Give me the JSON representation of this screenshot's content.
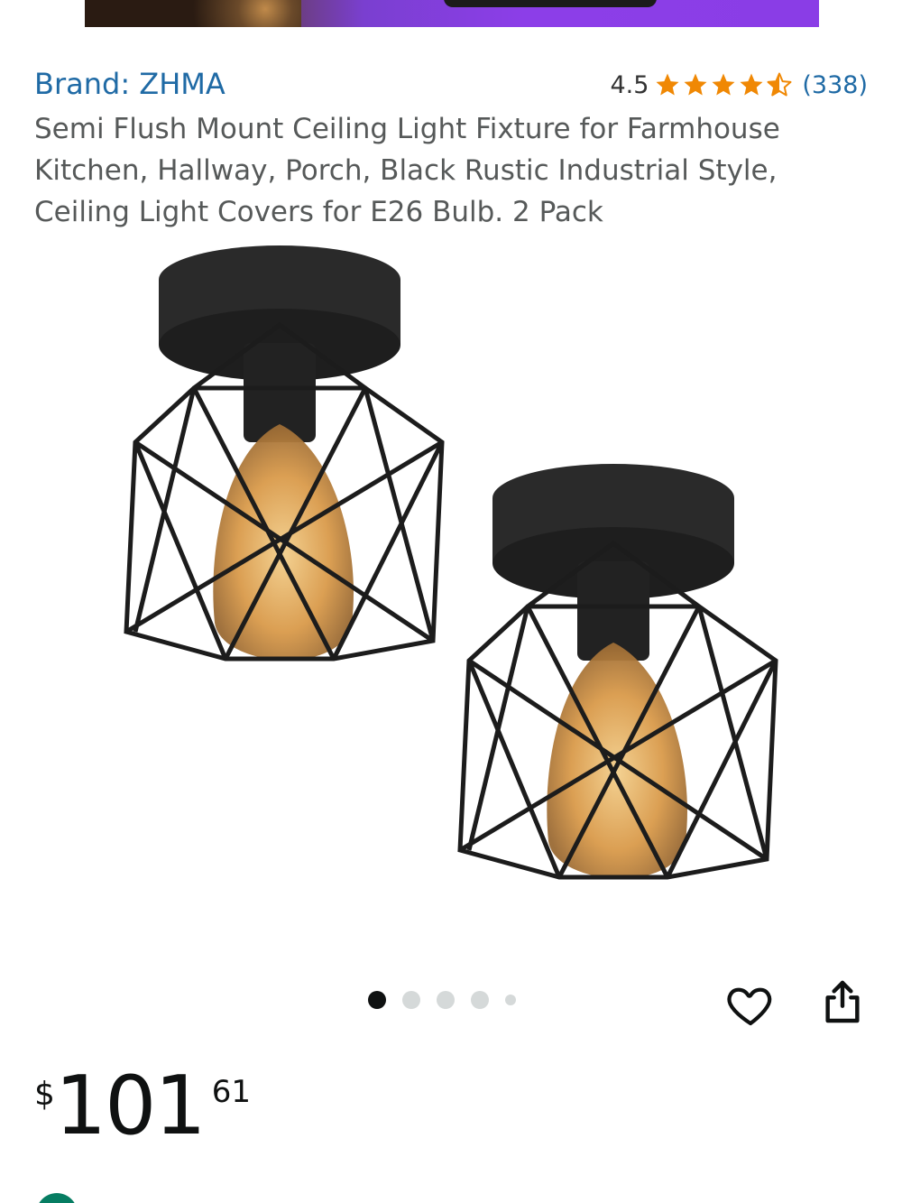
{
  "listing": {
    "brand": "Brand: ZHMA",
    "rating_value": "4.5",
    "rating_count": "(338)",
    "stars": 4.5,
    "title": "Semi Flush Mount Ceiling Light Fixture for Farmhouse Kitchen, Hallway, Porch, Black Rustic Industrial Style, Ceiling Light Covers for E26 Bulb. 2 Pack"
  },
  "gallery": {
    "image_count": 5,
    "active_index": 0
  },
  "price": {
    "symbol": "$",
    "whole": "101",
    "fraction": "61"
  },
  "colors": {
    "link": "#1f6aa5",
    "star": "#f08804",
    "text_secondary": "#565959",
    "promo": "#067d62"
  }
}
